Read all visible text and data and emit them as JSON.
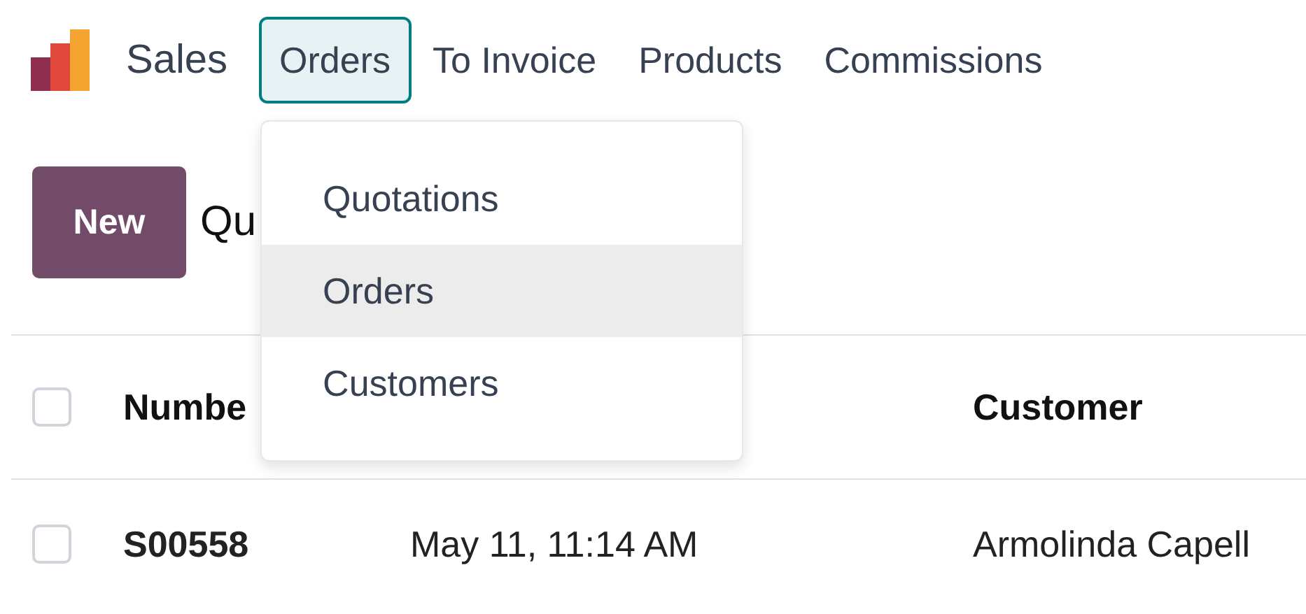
{
  "app": {
    "name": "Sales"
  },
  "menu": [
    {
      "label": "Orders",
      "selected": true
    },
    {
      "label": "To Invoice",
      "selected": false
    },
    {
      "label": "Products",
      "selected": false
    },
    {
      "label": "Commissions",
      "selected": false
    }
  ],
  "dropdown": {
    "items": [
      {
        "label": "Quotations",
        "selected": false
      },
      {
        "label": "Orders",
        "selected": true
      },
      {
        "label": "Customers",
        "selected": false
      }
    ]
  },
  "toolbar": {
    "new_button": "New",
    "title": "Qu"
  },
  "table": {
    "header": {
      "checked": false,
      "number": "Numbe",
      "customer": "Customer"
    },
    "rows": [
      {
        "checked": false,
        "number": "S00558",
        "date": "May 11, 11:14 AM",
        "customer": "Armolinda Capell"
      }
    ]
  }
}
